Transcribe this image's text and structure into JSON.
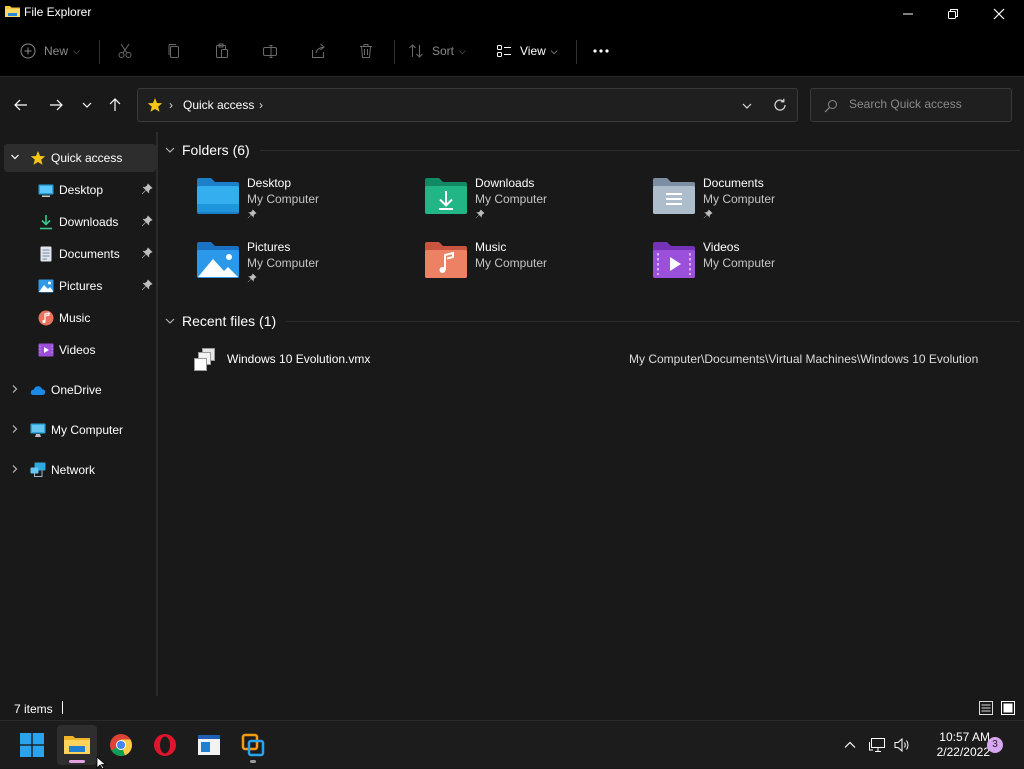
{
  "window": {
    "title": "File Explorer"
  },
  "toolbar": {
    "new_label": "New",
    "sort_label": "Sort",
    "view_label": "View"
  },
  "address": {
    "crumbs": [
      "Quick access"
    ]
  },
  "search": {
    "placeholder": "Search Quick access"
  },
  "sidebar": {
    "quick_access": "Quick access",
    "pinned": [
      {
        "label": "Desktop",
        "icon": "desktop-icon"
      },
      {
        "label": "Downloads",
        "icon": "downloads-icon"
      },
      {
        "label": "Documents",
        "icon": "documents-icon"
      },
      {
        "label": "Pictures",
        "icon": "pictures-icon"
      },
      {
        "label": "Music",
        "icon": "music-icon"
      },
      {
        "label": "Videos",
        "icon": "videos-icon"
      }
    ],
    "roots": [
      {
        "label": "OneDrive",
        "icon": "onedrive-icon"
      },
      {
        "label": "My Computer",
        "icon": "computer-icon"
      },
      {
        "label": "Network",
        "icon": "network-icon"
      }
    ]
  },
  "folders": {
    "header": "Folders (6)",
    "items": [
      {
        "name": "Desktop",
        "location": "My Computer",
        "pinned": true
      },
      {
        "name": "Downloads",
        "location": "My Computer",
        "pinned": true
      },
      {
        "name": "Documents",
        "location": "My Computer",
        "pinned": true
      },
      {
        "name": "Pictures",
        "location": "My Computer",
        "pinned": true
      },
      {
        "name": "Music",
        "location": "My Computer",
        "pinned": false
      },
      {
        "name": "Videos",
        "location": "My Computer",
        "pinned": false
      }
    ]
  },
  "recent": {
    "header": "Recent files (1)",
    "items": [
      {
        "name": "Windows 10 Evolution.vmx",
        "path": "My Computer\\Documents\\Virtual Machines\\Windows 10 Evolution"
      }
    ]
  },
  "status": {
    "count": "7 items"
  },
  "taskbar": {
    "time": "10:57 AM",
    "date": "2/22/2022",
    "notifications": "3"
  }
}
